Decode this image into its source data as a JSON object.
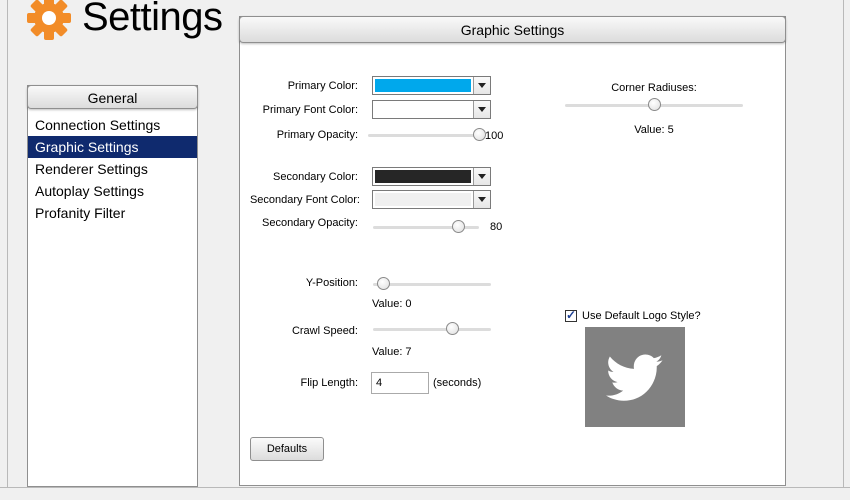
{
  "header": {
    "title": "Settings",
    "icon": "gear-icon",
    "icon_color": "#f28c28"
  },
  "sidebar": {
    "title": "General",
    "items": [
      {
        "label": "Connection Settings",
        "selected": false
      },
      {
        "label": "Graphic Settings",
        "selected": true
      },
      {
        "label": "Renderer Settings",
        "selected": false
      },
      {
        "label": "Autoplay Settings",
        "selected": false
      },
      {
        "label": "Profanity Filter",
        "selected": false
      }
    ],
    "selected_color": "#0f2a6e"
  },
  "main": {
    "title": "Graphic Settings",
    "primary_color": {
      "label": "Primary Color:",
      "value": "#00a8ec"
    },
    "primary_font_color": {
      "label": "Primary Font Color:",
      "value": "#ffffff"
    },
    "primary_opacity": {
      "label": "Primary Opacity:",
      "value": "100",
      "fraction": 1.0
    },
    "secondary_color": {
      "label": "Secondary Color:",
      "value": "#262626"
    },
    "secondary_font_color": {
      "label": "Secondary Font Color:",
      "value": "#f0f0f0"
    },
    "secondary_opacity": {
      "label": "Secondary Opacity:",
      "value": "80",
      "fraction": 0.8
    },
    "y_position": {
      "label": "Y-Position:",
      "value_label": "Value:  0",
      "fraction": 0.0
    },
    "crawl_speed": {
      "label": "Crawl Speed:",
      "value_label": "Value:  7",
      "fraction": 0.7
    },
    "flip_length": {
      "label": "Flip Length:",
      "value": "4",
      "unit": "(seconds)"
    },
    "corner_radiuses": {
      "label": "Corner Radiuses:",
      "value_label": "Value: 5",
      "fraction": 0.5
    },
    "use_default_logo": {
      "label": "Use Default Logo Style?",
      "checked": true
    },
    "logo": {
      "icon": "twitter-bird-icon",
      "background": "#818181"
    },
    "defaults_button": "Defaults"
  }
}
